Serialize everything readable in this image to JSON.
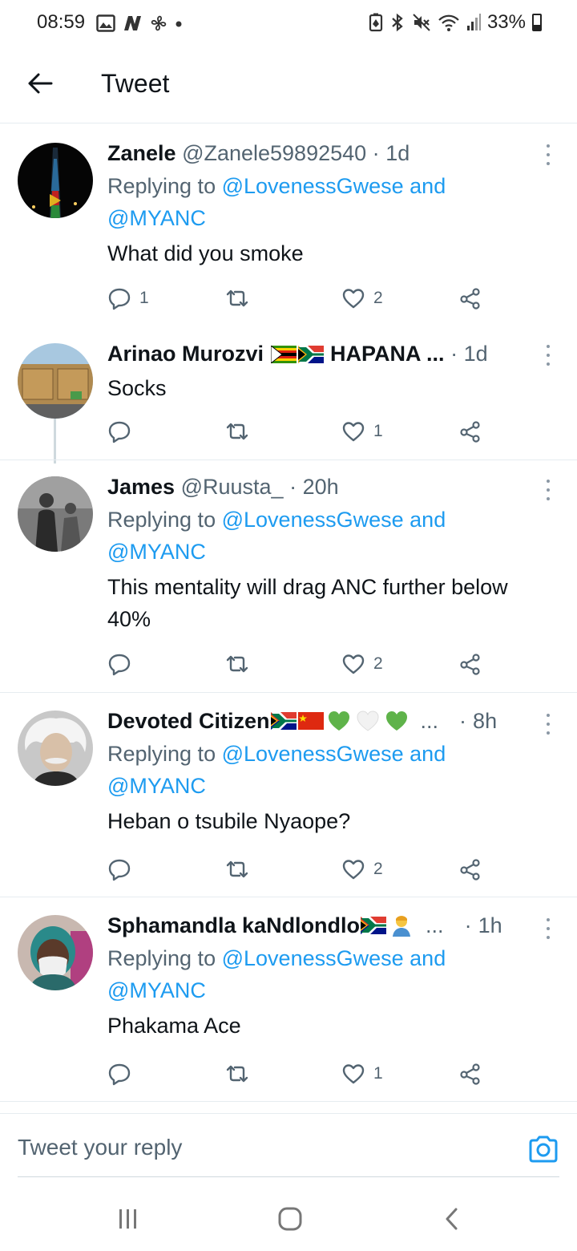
{
  "status_bar": {
    "time": "08:59",
    "battery": "33%",
    "left_icons": [
      "gallery-icon",
      "n-icon",
      "pinwheel-icon",
      "dot-icon"
    ],
    "right_icons": [
      "battery-saver-icon",
      "bluetooth-icon",
      "mute-icon",
      "wifi-icon",
      "signal-icon",
      "battery-icon"
    ]
  },
  "header": {
    "title": "Tweet"
  },
  "tweets": [
    {
      "name": "Zanele",
      "handle": "@Zanele59892540",
      "dot": "·",
      "time": "1d",
      "reply_prefix": "Replying to",
      "mention1": "@LovenessGwese",
      "and": "and",
      "mention2": "@MYANC",
      "text": "What did you smoke",
      "reply_count": "1",
      "retweet_count": "",
      "like_count": "2"
    },
    {
      "name": "Arinao Murozvi",
      "name_suffix": "HAPANA ...",
      "dot": "·",
      "time": "1d",
      "text": "Socks",
      "reply_count": "",
      "retweet_count": "",
      "like_count": "1"
    },
    {
      "name": "James",
      "handle": "@Ruusta_",
      "dot": "·",
      "time": "20h",
      "reply_prefix": "Replying to",
      "mention1": "@LovenessGwese",
      "and": "and",
      "mention2": "@MYANC",
      "text": "This mentality will drag ANC further below 40%",
      "reply_count": "",
      "retweet_count": "",
      "like_count": "2"
    },
    {
      "name": "Devoted Citizen",
      "ellipsis": "...",
      "dot": "·",
      "time": "8h",
      "reply_prefix": "Replying to",
      "mention1": "@LovenessGwese",
      "and": "and",
      "mention2": "@MYANC",
      "text": "Heban o tsubile Nyaope?",
      "reply_count": "",
      "retweet_count": "",
      "like_count": "2"
    },
    {
      "name": "Sphamandla kaNdlondlo",
      "ellipsis": "...",
      "dot": "·",
      "time": "1h",
      "reply_prefix": "Replying to",
      "mention1": "@LovenessGwese",
      "and": "and",
      "mention2": "@MYANC",
      "text": "Phakama Ace",
      "reply_count": "",
      "retweet_count": "",
      "like_count": "1"
    }
  ],
  "reply_bar": {
    "placeholder": "Tweet your reply"
  },
  "colors": {
    "accent": "#1d9bf0",
    "text_primary": "#0f1419",
    "text_secondary": "#536471",
    "divider": "#e6ecf0"
  }
}
